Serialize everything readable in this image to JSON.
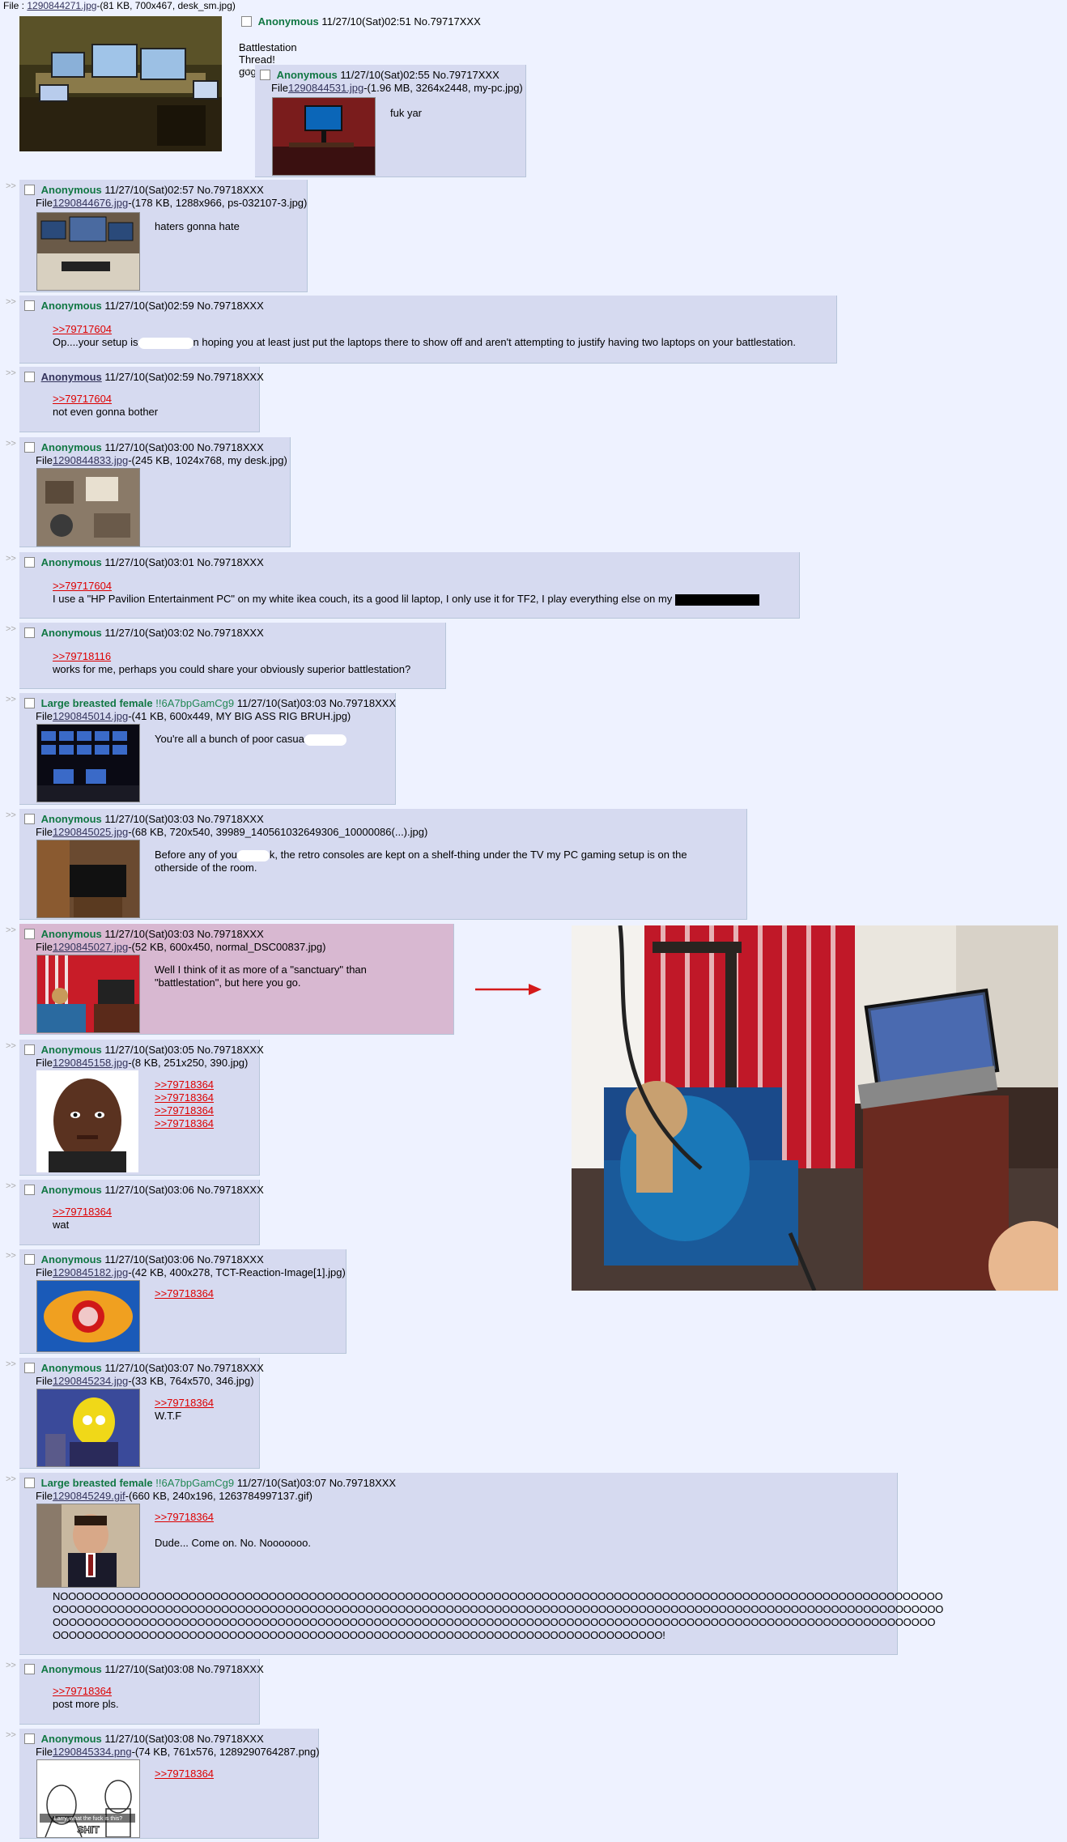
{
  "op": {
    "file_label": "File : ",
    "file_link": "1290844271.jpg",
    "file_meta": "-(81 KB, 700x467, desk_sm.jpg)",
    "name": "Anonymous",
    "date": "11/27/10(Sat)02:51",
    "no": "No.79717XXX",
    "comment": "Battlestation Thread! gogogogogo"
  },
  "posts": [
    {
      "name": "Anonymous",
      "date": "11/27/10(Sat)02:55",
      "no": "No.79717XXX",
      "file_link": "1290844531.jpg",
      "file_meta": "-(1.96 MB, 3264x2448, my-pc.jpg)",
      "text": "fuk yar"
    },
    {
      "name": "Anonymous",
      "date": "11/27/10(Sat)02:57",
      "no": "No.79718XXX",
      "file_link": "1290844676.jpg",
      "file_meta": "-(178 KB, 1288x966, ps-032107-3.jpg)",
      "text": "haters gonna hate"
    },
    {
      "name": "Anonymous",
      "date": "11/27/10(Sat)02:59",
      "no": "No.79718XXX",
      "quote": ">>79717604",
      "text_a": "Op....your setup is",
      "text_b": "n hoping you at least just put the laptops there to show off and aren't attempting to justify having two laptops on your battlestation."
    },
    {
      "name": "Anonymous",
      "date": "11/27/10(Sat)02:59",
      "no": "No.79718XXX",
      "quote": ">>79717604",
      "text": "not even gonna bother"
    },
    {
      "name": "Anonymous",
      "date": "11/27/10(Sat)03:00",
      "no": "No.79718XXX",
      "file_link": "1290844833.jpg",
      "file_meta": "-(245 KB, 1024x768, my desk.jpg)"
    },
    {
      "name": "Anonymous",
      "date": "11/27/10(Sat)03:01",
      "no": "No.79718XXX",
      "quote": ">>79717604",
      "text": "I use a \"HP Pavilion Entertainment PC\" on my white ikea couch, its a good lil laptop, I only use it for TF2, I play everything else on my"
    },
    {
      "name": "Anonymous",
      "date": "11/27/10(Sat)03:02",
      "no": "No.79718XXX",
      "quote": ">>79718116",
      "text": "works for me, perhaps you could share your obviously superior battlestation?"
    },
    {
      "name": "Large breasted female",
      "trip": "!!6A7bpGamCg9",
      "date": "11/27/10(Sat)03:03",
      "no": "No.79718XXX",
      "file_link": "1290845014.jpg",
      "file_meta": "-(41 KB, 600x449, MY BIG ASS RIG BRUH.jpg)",
      "text": "You're all a bunch of poor casua"
    },
    {
      "name": "Anonymous",
      "date": "11/27/10(Sat)03:03",
      "no": "No.79718XXX",
      "file_link": "1290845025.jpg",
      "file_meta": "-(68 KB, 720x540, 39989_140561032649306_10000086(...).jpg)",
      "text_a": "Before any of you",
      "text_b": "k, the retro consoles are kept on a shelf-thing under the TV my PC gaming setup is on the otherside of the room."
    },
    {
      "name": "Anonymous",
      "date": "11/27/10(Sat)03:03",
      "no": "No.79718XXX",
      "file_link": "1290845027.jpg",
      "file_meta": "-(52 KB, 600x450, normal_DSC00837.jpg)",
      "text": "Well I think of it as more of a \"sanctuary\" than \"battlestation\", but here you go."
    },
    {
      "name": "Anonymous",
      "date": "11/27/10(Sat)03:05",
      "no": "No.79718XXX",
      "file_link": "1290845158.jpg",
      "file_meta": "-(8 KB, 251x250, 390.jpg)",
      "quotes": [
        ">>79718364",
        ">>79718364",
        ">>79718364",
        ">>79718364"
      ]
    },
    {
      "name": "Anonymous",
      "date": "11/27/10(Sat)03:06",
      "no": "No.79718XXX",
      "quote": ">>79718364",
      "text": "wat"
    },
    {
      "name": "Anonymous",
      "date": "11/27/10(Sat)03:06",
      "no": "No.79718XXX",
      "file_link": "1290845182.jpg",
      "file_meta": "-(42 KB, 400x278, TCT-Reaction-Image[1].jpg)",
      "quote": ">>79718364"
    },
    {
      "name": "Anonymous",
      "date": "11/27/10(Sat)03:07",
      "no": "No.79718XXX",
      "file_link": "1290845234.jpg",
      "file_meta": "-(33 KB, 764x570, 346.jpg)",
      "quote": ">>79718364",
      "text": "W.T.F"
    },
    {
      "name": "Large breasted female",
      "trip": "!!6A7bpGamCg9",
      "date": "11/27/10(Sat)03:07",
      "no": "No.79718XXX",
      "file_link": "1290845249.gif",
      "file_meta": "-(660 KB, 240x196, 1263784997137.gif)",
      "quote": ">>79718364",
      "text": "Dude... Come on. No. Nooooooo.",
      "text2_l1": "NOOOOOOOOOOOOOOOOOOOOOOOOOOOOOOOOOOOOOOOOOOOOOOOOOOOOOOOOOOOOOOOOOOOOOOOOOOOOOOOOOOOOOOOOOOOOOOOOOOOOOOOOOOOOOO",
      "text2_l2": "OOOOOOOOOOOOOOOOOOOOOOOOOOOOOOOOOOOOOOOOOOOOOOOOOOOOOOOOOOOOOOOOOOOOOOOOOOOOOOOOOOOOOOOOOOOOOOOOOOOOOOOOOOOOOOO",
      "text2_l3": "OOOOOOOOOOOOOOOOOOOOOOOOOOOOOOOOOOOOOOOOOOOOOOOOOOOOOOOOOOOOOOOOOOOOOOOOOOOOOOOOOOOOOOOOOOOOOOOOOOOOOOOOOOOOOO",
      "text2_l4": "OOOOOOOOOOOOOOOOOOOOOOOOOOOOOOOOOOOOOOOOOOOOOOOOOOOOOOOOOOOOOOOOOOOOOOOOOOOO!"
    },
    {
      "name": "Anonymous",
      "date": "11/27/10(Sat)03:08",
      "no": "No.79718XXX",
      "quote": ">>79718364",
      "text": "post more pls."
    },
    {
      "name": "Anonymous",
      "date": "11/27/10(Sat)03:08",
      "no": "No.79718XXX",
      "file_link": "1290845334.png",
      "file_meta": "-(74 KB, 761x576, 1289290764287.png)",
      "quote": ">>79718364",
      "thumb_caption_1": "Larry, what the fuck is this?",
      "thumb_caption_2": "SHIT"
    }
  ],
  "file_prefix": "File",
  "arrow_glyph": ">>",
  "pointer_arrow": "→"
}
